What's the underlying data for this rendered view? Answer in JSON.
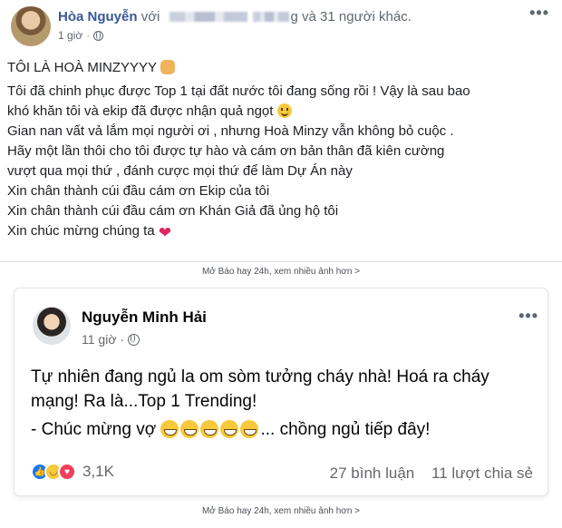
{
  "post1": {
    "author": "Hòa Nguyễn",
    "with_text": "với",
    "blur_suffix": "g",
    "others_text": "và 31 người khác.",
    "time": "1 giờ",
    "dot": "·",
    "lines": [
      "TÔI LÀ HOÀ MINZYYYY",
      "Tôi đã chinh phục được Top 1 tại đất nước tôi đang sống rồi ! Vậy là sau bao",
      "khó khăn tôi và ekip đã được nhận quả ngọt",
      "Gian nan vất vả lắm mọi người ơi , nhưng Hoà Minzy vẫn không bỏ cuộc .",
      "Hãy một lần thôi cho tôi được tự hào và cám ơn bản thân đã kiên cường",
      "vượt qua mọi thứ , đánh cược mọi thứ để làm Dự Án này",
      "Xin chân thành cúi đầu cám ơn Ekip của tôi",
      "Xin chân thành cúi đầu cám ơn Khán Giả đã ủng hộ tôi",
      "Xin chúc mừng chúng ta"
    ],
    "heart": "❤"
  },
  "footer_link": "Mở Báo hay 24h, xem nhiều ảnh hơn >",
  "post2": {
    "author": "Nguyễn Minh Hải",
    "time": "11 giờ",
    "dot": "·",
    "lines": [
      "Tự nhiên đang ngủ la om sòm tưởng cháy nhà! Hoá ra cháy",
      "mạng! Ra là...Top 1 Trending!"
    ],
    "line3_prefix": "- Chúc mừng vợ",
    "line3_suffix": "... chồng ngủ tiếp đây!",
    "reaction_count": "3,1K",
    "comments": "27 bình luận",
    "shares": "11 lượt chia sẻ"
  },
  "more_glyph": "•••",
  "icons": [
    "globe-icon",
    "more-options-icon",
    "like-reaction-icon",
    "haha-reaction-icon",
    "love-reaction-icon"
  ]
}
